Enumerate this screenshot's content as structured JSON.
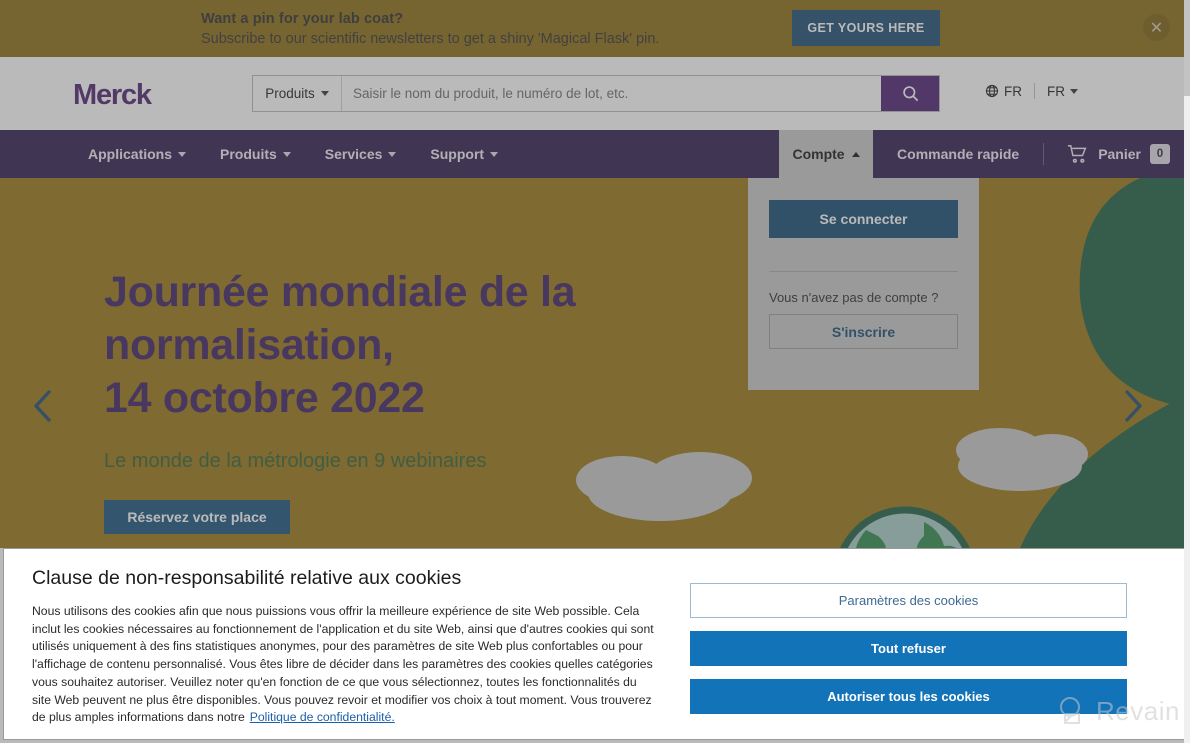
{
  "promo": {
    "title": "Want a pin for your lab coat?",
    "subtitle": "Subscribe to our scientific newsletters to get a shiny 'Magical Flask' pin.",
    "cta": "GET YOURS HERE",
    "close": "✕",
    "bg_color": "#8c6d14",
    "cta_color": "#1b4c73"
  },
  "header": {
    "logo": "Merck",
    "logo_color": "#4f2170",
    "search": {
      "category": "Produits",
      "placeholder": "Saisir le nom du produit, le numéro de lot, etc.",
      "value": "",
      "button_color": "#4b2073"
    },
    "locale": "FR",
    "language": "FR"
  },
  "nav": {
    "bg_color": "#2e1a4d",
    "items": [
      {
        "label": "Applications"
      },
      {
        "label": "Produits"
      },
      {
        "label": "Services"
      },
      {
        "label": "Support"
      }
    ],
    "account_tab": "Compte",
    "quick_order": "Commande rapide",
    "cart_label": "Panier",
    "cart_count": "0"
  },
  "account_panel": {
    "sign_in": "Se connecter",
    "no_account": "Vous n'avez pas de compte ?",
    "register": "S'inscrire",
    "bg_color": "#c9c9c9",
    "sign_in_color": "#134a73"
  },
  "hero": {
    "bg_color": "#9a7613",
    "title": "Journée mondiale de la\nnormalisation,\n14 octobre 2022",
    "title_color": "#3c1f63",
    "subtitle": "Le monde de la métrologie en 9 webinaires",
    "subtitle_color": "#2f6033",
    "cta": "Réservez votre place",
    "cta_color": "#17527c",
    "prev": "‹",
    "next": "›"
  },
  "cookie": {
    "title": "Clause de non-responsabilité relative aux cookies",
    "body": "Nous utilisons des cookies afin que nous puissions vous offrir la meilleure expérience de site Web possible. Cela inclut les cookies nécessaires au fonctionnement de l'application et du site Web, ainsi que d'autres cookies qui sont utilisés uniquement à des fins statistiques anonymes, pour des paramètres de site Web plus confortables ou pour l'affichage de contenu personnalisé. Vous êtes libre de décider dans les paramètres des cookies quelles catégories vous souhaitez autoriser. Veuillez noter qu'en fonction de ce que vous sélectionnez, toutes les fonctionnalités du site Web peuvent ne plus être disponibles. Vous pouvez revoir et modifier vos choix à tout moment. Vous trouverez de plus amples informations dans notre",
    "link": "Politique de confidentialité.",
    "settings": "Paramètres des cookies",
    "reject": "Tout refuser",
    "accept": "Autoriser tous les cookies",
    "primary_color": "#1273b8"
  },
  "watermark": {
    "text": "Revain"
  }
}
